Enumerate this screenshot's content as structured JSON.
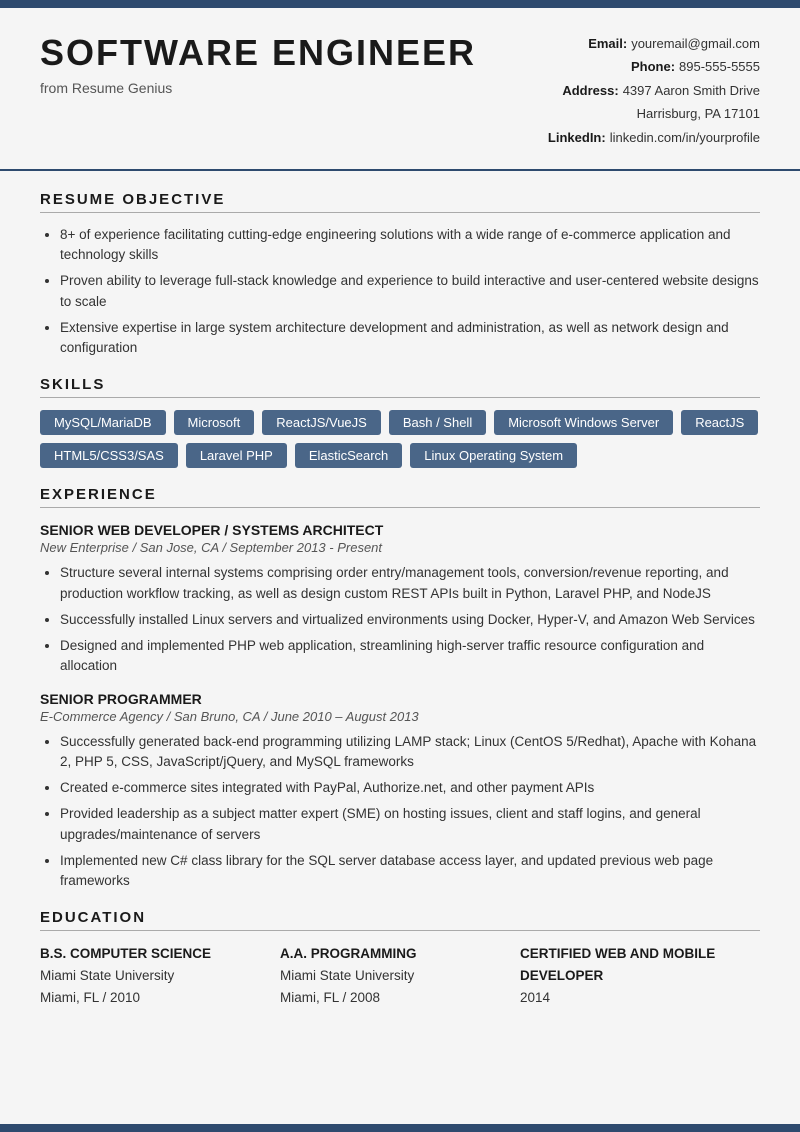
{
  "resume": {
    "top_bar_color": "#2e4a6e",
    "header": {
      "name": "SOFTWARE ENGINEER",
      "from": "from Resume Genius",
      "contact": {
        "email_label": "Email:",
        "email_value": "youremail@gmail.com",
        "phone_label": "Phone:",
        "phone_value": "895-555-5555",
        "address_label": "Address:",
        "address_value": "4397 Aaron Smith Drive",
        "address_city": "Harrisburg, PA 17101",
        "linkedin_label": "LinkedIn:",
        "linkedin_value": "linkedin.com/in/yourprofile"
      }
    },
    "sections": {
      "objective": {
        "title": "RESUME OBJECTIVE",
        "bullets": [
          "8+ of experience facilitating cutting-edge engineering solutions with a wide range of e-commerce application and technology skills",
          "Proven ability to leverage full-stack knowledge and experience to build interactive and user-centered website designs to scale",
          "Extensive expertise in large system architecture development and administration, as well as network design and configuration"
        ]
      },
      "skills": {
        "title": "SKILLS",
        "items": [
          "MySQL/MariaDB",
          "Microsoft",
          "ReactJS/VueJS",
          "Bash / Shell",
          "Microsoft Windows Server",
          "ReactJS",
          "HTML5/CSS3/SAS",
          "Laravel PHP",
          "ElasticSearch",
          "Linux Operating System"
        ]
      },
      "experience": {
        "title": "EXPERIENCE",
        "jobs": [
          {
            "title": "SENIOR WEB DEVELOPER / SYSTEMS ARCHITECT",
            "subtitle": "New Enterprise / San Jose, CA / September 2013 - Present",
            "bullets": [
              "Structure several internal systems comprising order entry/management tools, conversion/revenue reporting, and production workflow tracking, as well as design custom REST APIs built in Python, Laravel PHP, and NodeJS",
              "Successfully installed Linux servers and virtualized environments using Docker, Hyper-V, and Amazon Web Services",
              "Designed and implemented PHP web application, streamlining high-server traffic resource configuration and allocation"
            ]
          },
          {
            "title": "SENIOR PROGRAMMER",
            "subtitle": "E-Commerce Agency / San Bruno, CA / June 2010 – August 2013",
            "bullets": [
              "Successfully generated back-end programming utilizing LAMP stack; Linux (CentOS 5/Redhat), Apache with Kohana 2, PHP 5, CSS, JavaScript/jQuery, and MySQL frameworks",
              "Created e-commerce sites integrated with PayPal, Authorize.net, and other payment APIs",
              "Provided leadership as a subject matter expert (SME) on hosting issues, client and staff logins, and general upgrades/maintenance of servers",
              "Implemented new C# class library for the SQL server database access layer, and updated previous web page frameworks"
            ]
          }
        ]
      },
      "education": {
        "title": "EDUCATION",
        "degrees": [
          {
            "degree": "B.S. COMPUTER SCIENCE",
            "school": "Miami State University",
            "location_year": "Miami, FL / 2010"
          },
          {
            "degree": "A.A. PROGRAMMING",
            "school": "Miami State University",
            "location_year": "Miami, FL / 2008"
          },
          {
            "degree": "CERTIFIED WEB AND MOBILE DEVELOPER",
            "school": "",
            "location_year": "2014"
          }
        ]
      }
    }
  }
}
